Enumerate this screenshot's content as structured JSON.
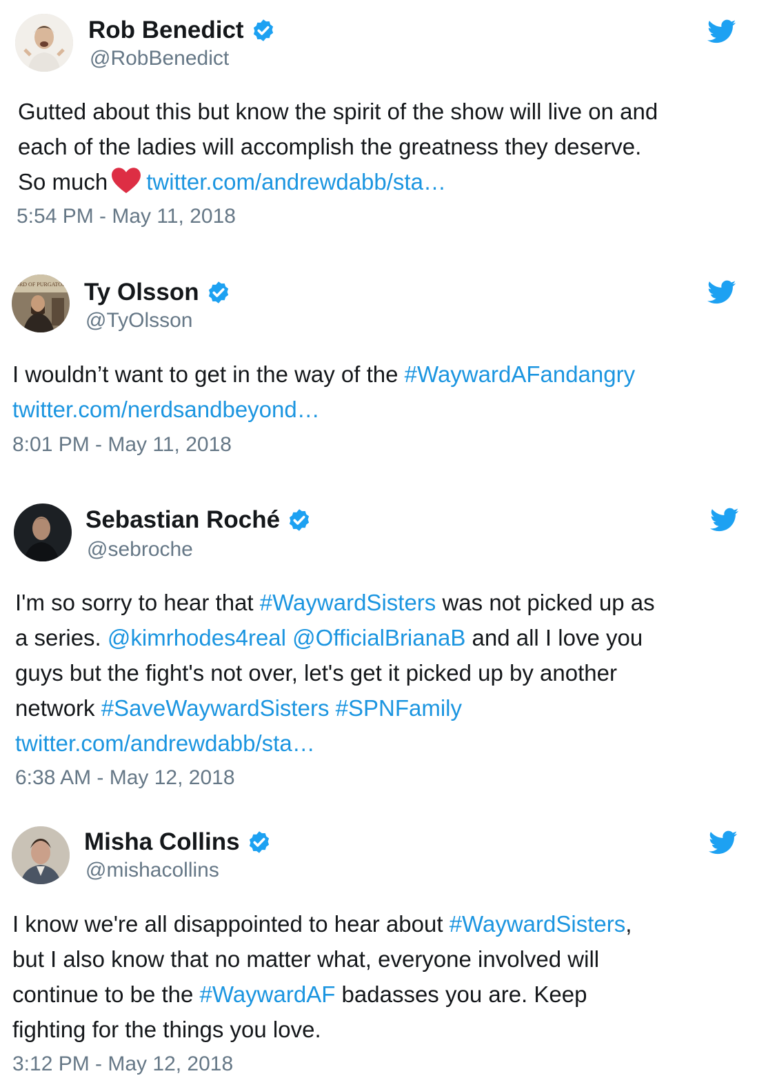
{
  "colors": {
    "link": "#1b95e0",
    "verified": "#1da1f2",
    "bird": "#1da1f2",
    "heart": "#dd2e44",
    "muted": "#657786"
  },
  "icons": {
    "verified": "verified-badge-icon",
    "brand": "twitter-bird-icon",
    "emoji": "red-heart-icon"
  },
  "tweets": [
    {
      "name": "Rob Benedict",
      "handle": "@RobBenedict",
      "line1": "Gutted about this but know the spirit of the show will live on and",
      "line2": "each of the ladies will accomplish the greatness they deserve.",
      "line3_text": "So much",
      "line3_link": "twitter.com/andrewdabb/sta…",
      "time": "5:54 PM - May 11, 2018"
    },
    {
      "name": "Ty Olsson",
      "handle": "@TyOlsson",
      "avatar_sign": "LORD OF PURGATORY",
      "line1_text": "I wouldn’t want to get in the way of the ",
      "line1_link": "#WaywardAFandangry",
      "line2_link": "twitter.com/nerdsandbeyond…",
      "time": "8:01 PM - May 11, 2018"
    },
    {
      "name": "Sebastian Roché",
      "handle": "@sebroche",
      "line1_a": "I'm so sorry to hear that ",
      "line1_link": "#WaywardSisters",
      "line1_b": " was not picked up as",
      "line2_a": "a series. ",
      "line2_link1": "@kimrhodes4real",
      "line2_sp": " ",
      "line2_link2": "@OfficialBrianaB",
      "line2_b": " and all I love you",
      "line3": "guys but the fight's not over, let's get it picked up by another",
      "line4_a": "network ",
      "line4_link1": "#SaveWaywardSisters",
      "line4_sp": " ",
      "line4_link2": "#SPNFamily",
      "line5_link": "twitter.com/andrewdabb/sta…",
      "time": "6:38 AM - May 12, 2018"
    },
    {
      "name": "Misha Collins",
      "handle": "@mishacollins",
      "line1_a": "I know we're all disappointed to hear about ",
      "line1_link": "#WaywardSisters",
      "line1_b": ",",
      "line2": "but I also know that no matter what, everyone involved will",
      "line3_a": "continue to be the ",
      "line3_link": "#WaywardAF",
      "line3_b": " badasses you are. Keep",
      "line4": "fighting for the things you love.",
      "time": "3:12 PM - May 12, 2018"
    }
  ]
}
